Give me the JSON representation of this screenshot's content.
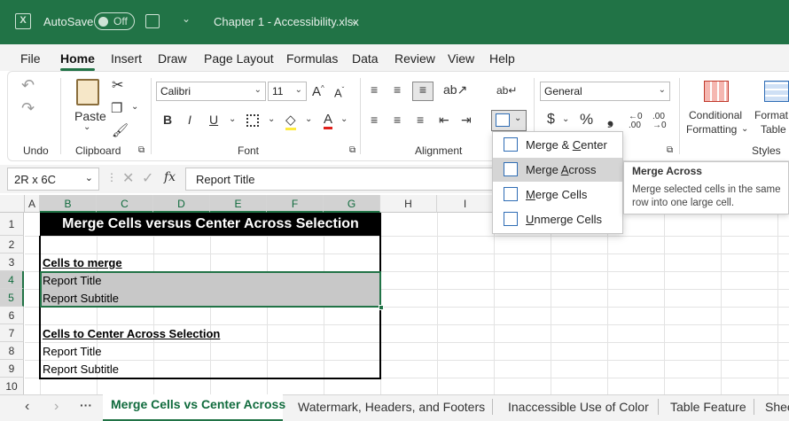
{
  "titlebar": {
    "autosave_label": "AutoSave",
    "autosave_state": "Off",
    "file_title": "Chapter 1 - Accessibility.xlsx",
    "bg_color": "#217346"
  },
  "menu": [
    "File",
    "Home",
    "Insert",
    "Draw",
    "Page Layout",
    "Formulas",
    "Data",
    "Review",
    "View",
    "Help"
  ],
  "ribbon": {
    "undo_label": "Undo",
    "paste_label": "Paste",
    "clipboard_label": "Clipboard",
    "font_name": "Calibri",
    "font_size": "11",
    "font_label": "Font",
    "alignment_label": "Alignment",
    "number_format": "General",
    "conditional_formatting": [
      "Conditional",
      "Formatting"
    ],
    "format_table": [
      "Format",
      "Table"
    ],
    "styles_label": "Styles",
    "bold": "B",
    "italic": "I",
    "underline": "U",
    "currency": "$",
    "percent": "%",
    "comma": "❟"
  },
  "formula": {
    "name_box": "2R x 6C",
    "content": "Report Title",
    "fx": "fx"
  },
  "columns": [
    "A",
    "B",
    "C",
    "D",
    "E",
    "F",
    "G",
    "H",
    "I"
  ],
  "rows": [
    "1",
    "2",
    "3",
    "4",
    "5",
    "6",
    "7",
    "8",
    "9",
    "10"
  ],
  "cells": {
    "title": "Merge Cells versus Center Across Selection",
    "r3": "Cells to merge",
    "r4": "Report Title",
    "r5": "Report Subtitle",
    "r7": "Cells to Center Across Selection",
    "r8": "Report Title",
    "r9": "Report Subtitle"
  },
  "dropdown": {
    "items": [
      {
        "pre": "Merge & ",
        "u": "C",
        "post": "enter"
      },
      {
        "pre": "Merge ",
        "u": "A",
        "post": "cross"
      },
      {
        "pre": "",
        "u": "M",
        "post": "erge Cells"
      },
      {
        "pre": "",
        "u": "U",
        "post": "nmerge Cells"
      }
    ]
  },
  "tooltip": {
    "title": "Merge Across",
    "body": "Merge selected cells in the same row into one large cell."
  },
  "sheet_tabs": [
    "Merge Cells vs Center Across",
    "Watermark, Headers, and Footers",
    "Inaccessible Use of Color",
    "Table Feature",
    "Shee"
  ]
}
